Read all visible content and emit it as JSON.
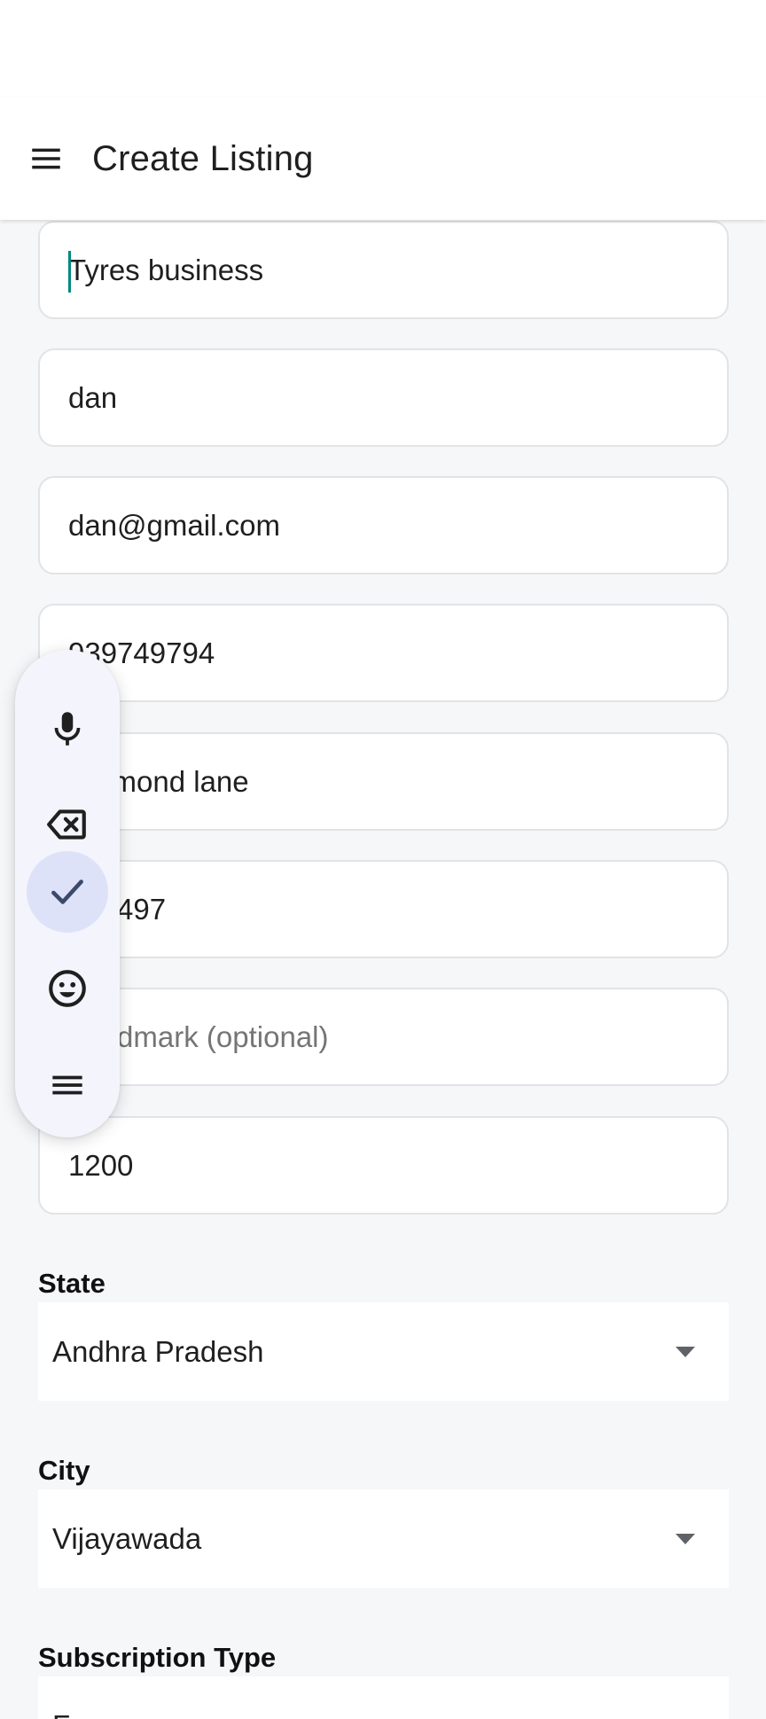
{
  "app_bar": {
    "title": "Create Listing",
    "menu_icon": "hamburger-menu-icon"
  },
  "fields": [
    {
      "name": "business-name-field",
      "value": "Tyres business"
    },
    {
      "name": "contact-name-field",
      "value": "dan"
    },
    {
      "name": "email-field",
      "value": "dan@gmail.com"
    },
    {
      "name": "phone-field",
      "value": "939749794"
    },
    {
      "name": "address-field",
      "value": "Diamond lane"
    },
    {
      "name": "pincode-field",
      "value": "533497"
    },
    {
      "name": "landmark-field",
      "placeholder": "Landmark (optional)"
    },
    {
      "name": "price-field",
      "value": "1200"
    }
  ],
  "state": {
    "label": "State",
    "value": "Andhra Pradesh"
  },
  "city": {
    "label": "City",
    "value": "Vijayawada"
  },
  "subscription": {
    "label": "Subscription Type",
    "value": "Free"
  },
  "keyboard_toolbar": {
    "icons": [
      "microphone-icon",
      "backspace-icon",
      "checkmark-icon",
      "emoji-icon",
      "menu-lines-icon"
    ],
    "active_color": "#dde2f9",
    "icon_color": "#3b4a6b"
  }
}
